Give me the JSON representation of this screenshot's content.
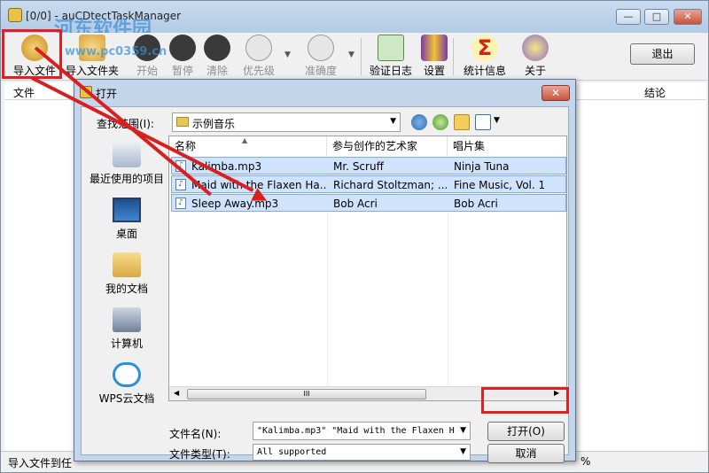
{
  "window": {
    "title": "[0/0] - auCDtectTaskManager",
    "watermark_cn": "河东软件园",
    "watermark_url": "www.pc0359.cn",
    "min_label": "—",
    "max_label": "□",
    "close_label": "✕"
  },
  "toolbar": {
    "import_file": "导入文件",
    "import_folder": "导入文件夹",
    "start": "开始",
    "pause": "暂停",
    "clear": "清除",
    "priority": "优先级",
    "accuracy": "准确度",
    "verify_log": "验证日志",
    "settings": "设置",
    "stats": "统计信息",
    "about": "关于",
    "exit": "退出"
  },
  "main_list": {
    "col_file": "文件",
    "col_result": "结论"
  },
  "statusbar": {
    "text": "导入文件到任",
    "right_text": "%"
  },
  "dialog": {
    "title": "打开",
    "look_in_label": "查找范围(I):",
    "look_in_value": "示例音乐",
    "places": [
      {
        "label": "最近使用的项目"
      },
      {
        "label": "桌面"
      },
      {
        "label": "我的文档"
      },
      {
        "label": "计算机"
      },
      {
        "label": "WPS云文档"
      }
    ],
    "columns": {
      "name": "名称",
      "artist": "参与创作的艺术家",
      "album": "唱片集"
    },
    "files": [
      {
        "name": "Kalimba.mp3",
        "artist": "Mr. Scruff",
        "album": "Ninja Tuna"
      },
      {
        "name": "Maid with the Flaxen Ha...",
        "artist": "Richard Stoltzman; ...",
        "album": "Fine Music, Vol. 1"
      },
      {
        "name": "Sleep Away.mp3",
        "artist": "Bob Acri",
        "album": "Bob Acri"
      }
    ],
    "filename_label": "文件名(N):",
    "filename_value": "\"Kalimba.mp3\" \"Maid with the Flaxen H",
    "filetype_label": "文件类型(T):",
    "filetype_value": "All supported",
    "open_button": "打开(O)",
    "cancel_button": "取消",
    "scroll_grip": "III"
  },
  "colors": {
    "highlight_red": "#e02020",
    "selection_blue": "#cfe3fc"
  }
}
